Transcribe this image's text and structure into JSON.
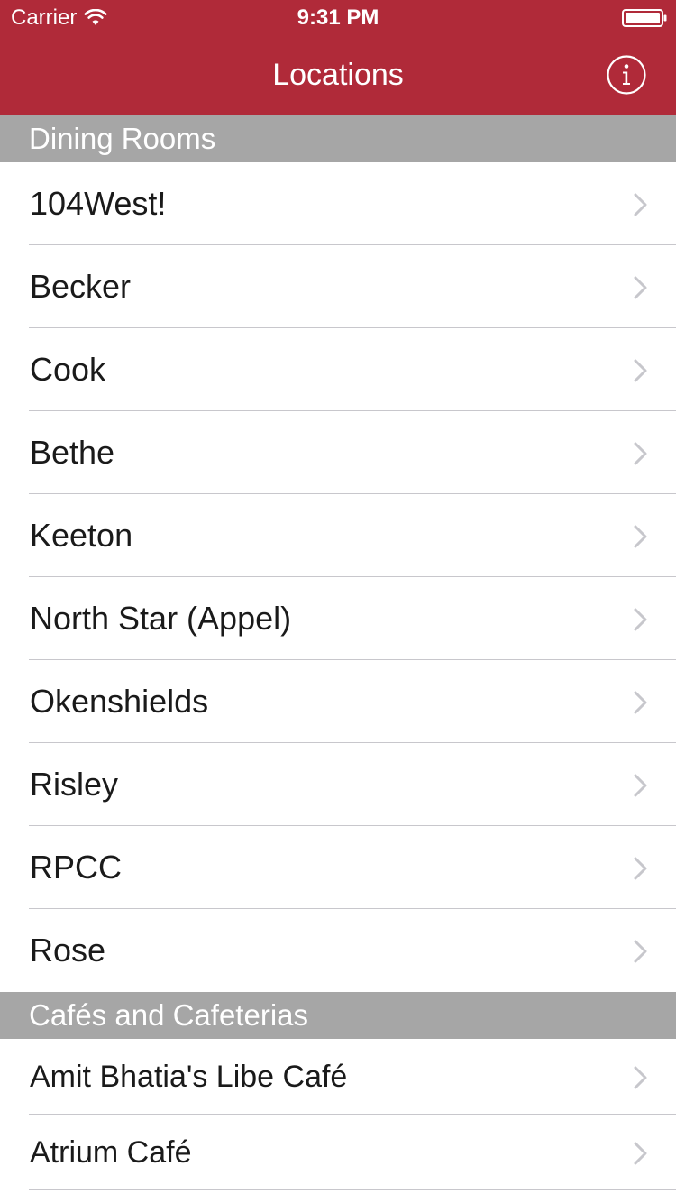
{
  "status_bar": {
    "carrier": "Carrier",
    "time": "9:31 PM",
    "wifi_icon": "wifi-icon",
    "battery_icon": "battery-icon"
  },
  "nav_bar": {
    "title": "Locations",
    "info_icon": "info-icon",
    "color": "#b02a39"
  },
  "sections": [
    {
      "title": "Dining Rooms",
      "rows": [
        "104West!",
        "Becker",
        "Cook",
        "Bethe",
        "Keeton",
        "North Star (Appel)",
        "Okenshields",
        "Risley",
        "RPCC",
        "Rose"
      ]
    },
    {
      "title": "Cafés and Cafeterias",
      "rows": [
        "Amit Bhatia's Libe Café",
        "Atrium Café"
      ]
    }
  ]
}
